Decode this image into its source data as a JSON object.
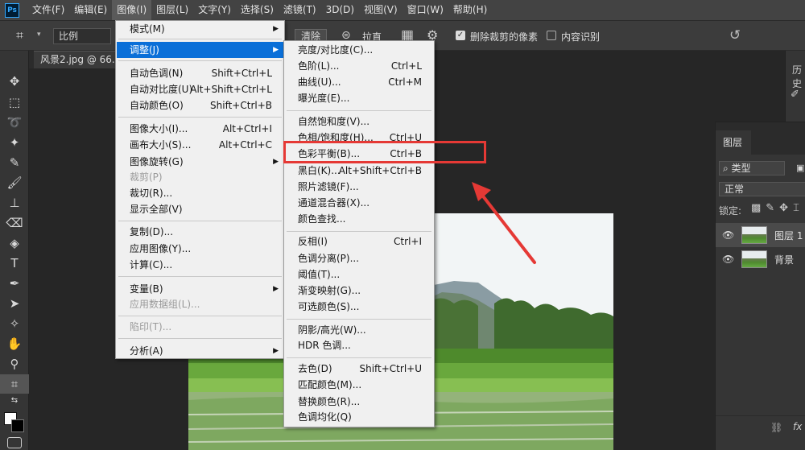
{
  "menubar": {
    "logo": "Ps",
    "items": [
      "文件(F)",
      "编辑(E)",
      "图像(I)",
      "图层(L)",
      "文字(Y)",
      "选择(S)",
      "滤镜(T)",
      "3D(D)",
      "视图(V)",
      "窗口(W)",
      "帮助(H)"
    ]
  },
  "options": {
    "ratio": "比例",
    "clear": "清除",
    "straighten": "拉直",
    "delete_cropped": "删除裁剪的像素",
    "content_aware": "内容识别"
  },
  "document": {
    "tab": "风景2.jpg @ 66.7%"
  },
  "image_menu": {
    "mode": "模式(M)",
    "adjust": "调整(J)",
    "auto_tone": {
      "label": "自动色调(N)",
      "shortcut": "Shift+Ctrl+L"
    },
    "auto_contrast": {
      "label": "自动对比度(U)",
      "shortcut": "Alt+Shift+Ctrl+L"
    },
    "auto_color": {
      "label": "自动颜色(O)",
      "shortcut": "Shift+Ctrl+B"
    },
    "image_size": {
      "label": "图像大小(I)...",
      "shortcut": "Alt+Ctrl+I"
    },
    "canvas_size": {
      "label": "画布大小(S)...",
      "shortcut": "Alt+Ctrl+C"
    },
    "rotation": "图像旋转(G)",
    "crop": "裁剪(P)",
    "trim": "裁切(R)...",
    "reveal_all": "显示全部(V)",
    "duplicate": "复制(D)...",
    "apply_image": "应用图像(Y)...",
    "calculations": "计算(C)...",
    "variables": "变量(B)",
    "apply_data_set": "应用数据组(L)...",
    "trap": "陷印(T)...",
    "analysis": "分析(A)"
  },
  "adjust_menu": {
    "brightness": "亮度/对比度(C)...",
    "levels": {
      "label": "色阶(L)...",
      "shortcut": "Ctrl+L"
    },
    "curves": {
      "label": "曲线(U)...",
      "shortcut": "Ctrl+M"
    },
    "exposure": "曝光度(E)...",
    "vibrance": "自然饱和度(V)...",
    "hue_sat": {
      "label": "色相/饱和度(H)...",
      "shortcut": "Ctrl+U"
    },
    "color_balance": {
      "label": "色彩平衡(B)...",
      "shortcut": "Ctrl+B"
    },
    "black_white": {
      "label": "黑白(K)...",
      "shortcut": "Alt+Shift+Ctrl+B"
    },
    "photo_filter": "照片滤镜(F)...",
    "channel_mixer": "通道混合器(X)...",
    "color_lookup": "颜色查找...",
    "invert": {
      "label": "反相(I)",
      "shortcut": "Ctrl+I"
    },
    "posterize": "色调分离(P)...",
    "threshold": "阈值(T)...",
    "gradient_map": "渐变映射(G)...",
    "selective_color": "可选颜色(S)...",
    "shadows": "阴影/高光(W)...",
    "hdr": "HDR 色调...",
    "desaturate": {
      "label": "去色(D)",
      "shortcut": "Shift+Ctrl+U"
    },
    "match_color": "匹配颜色(M)...",
    "replace_color": "替换颜色(R)...",
    "equalize": "色调均化(Q)"
  },
  "layers_panel": {
    "tab": "图层",
    "filter": "类型",
    "blend": "正常",
    "lock": "锁定:",
    "layers": [
      "图层 1",
      "背景"
    ],
    "fx": "fx"
  },
  "right_strip": {
    "label": "历史"
  },
  "colors": {
    "menu_highlight": "#0a6fd8",
    "annotation": "#e53935",
    "ps_blue": "#31a8ff"
  }
}
